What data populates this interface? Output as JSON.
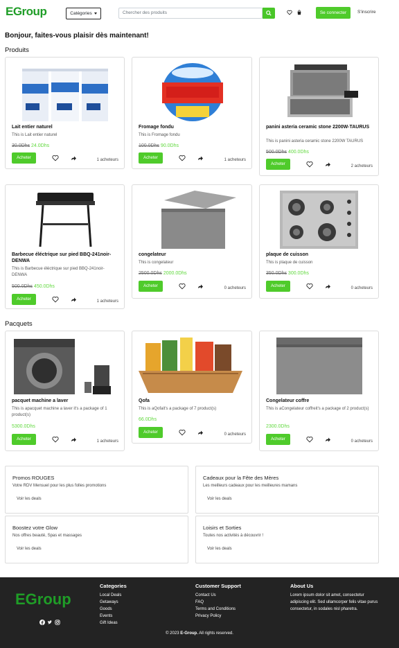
{
  "header": {
    "logo_text": "EGroup",
    "categories_label": "Catégories",
    "search_placeholder": "Chercher des produits",
    "login_label": "Se connecter",
    "signup_label": "S'inscrire"
  },
  "greeting": "Bonjour, faites-vous plaisir dès maintenant!",
  "sections": {
    "products_title": "Produits",
    "packages_title": "Pacquets"
  },
  "products": [
    {
      "name": "Lait entier naturel",
      "desc": "This is Lait entier naturel",
      "old_price": "30.0Dhs",
      "new_price": "24.0Dhs",
      "buy_label": "Acheter",
      "buyers": "1 acheteurs"
    },
    {
      "name": "Fromage fondu",
      "desc": "This is Fromage fondu",
      "old_price": "100.0Dhs",
      "new_price": "90.0Dhs",
      "buy_label": "Acheter",
      "buyers": "1 acheteurs"
    },
    {
      "name": "panini asteria ceramic stone 2200W-TAURUS",
      "desc": "This is panini asteria ceramic stone 2200W TAURUS",
      "old_price": "500.0Dhs",
      "new_price": "400.0Dhs",
      "buy_label": "Acheter",
      "buyers": "2 acheteurs"
    },
    {
      "name": "Barbecue éléctrique sur pied BBQ-241noir-DENWA",
      "desc": "This is Barbecue éléctrique sur pied BBQ-241noir-DENWA",
      "old_price": "500.0Dhs",
      "new_price": "450.0Dhs",
      "buy_label": "Acheter",
      "buyers": "1 acheteurs"
    },
    {
      "name": "congelateur",
      "desc": "This is congelateur",
      "old_price": "2500.0Dhs",
      "new_price": "2000.0Dhs",
      "buy_label": "Acheter",
      "buyers": "0 acheteurs"
    },
    {
      "name": "plaque de cuisson",
      "desc": "This is plaque de cuisson",
      "old_price": "350.0Dhs",
      "new_price": "300.0Dhs",
      "buy_label": "Acheter",
      "buyers": "0 acheteurs"
    }
  ],
  "packages": [
    {
      "name": "pacquet machine a laver",
      "desc": "This is apacquet machine a laver it's a package of 1 product(s)",
      "price": "5300.0Dhs",
      "buy_label": "Acheter",
      "buyers": "1 acheteurs"
    },
    {
      "name": "Qofa",
      "desc": "This is aQofait's a package of 7 product(s)",
      "price": "66.0Dhs",
      "buy_label": "Acheter",
      "buyers": "0 acheteurs"
    },
    {
      "name": "Congelateur coffre",
      "desc": "This is aCongelateur coffreit's a package of 2 product(s)",
      "price": "2300.0Dhs",
      "buy_label": "Acheter",
      "buyers": "0 acheteurs"
    }
  ],
  "promos": [
    {
      "title": "Promos ROUGES",
      "desc": "Votre RDV Mensuel pour les plus folles promotions",
      "link": "Voir les deals"
    },
    {
      "title": "Cadeaux pour la Fête des Mères",
      "desc": "Les meilleurs cadeaux pour les meilleures mamans",
      "link": "Voir les deals"
    },
    {
      "title": "Boostez votre Glow",
      "desc": "Nos offres beauté, Spas et massages",
      "link": "Voir les deals"
    },
    {
      "title": "Loisirs et Sorties",
      "desc": "Toutes nos activités à découvrir !",
      "link": "Voir les deals"
    }
  ],
  "footer": {
    "logo_text": "EGroup",
    "categories_title": "Categories",
    "categories": [
      "Local Deals",
      "Getaways",
      "Goods",
      "Events",
      "Gift Ideas"
    ],
    "support_title": "Customer Support",
    "support": [
      "Contact Us",
      "FAQ",
      "Terms and Conditions",
      "Privacy Policy"
    ],
    "about_title": "About Us",
    "about_text": "Lorem ipsum dolor sit amet, consectetur adipiscing elit. Sed ullamcorper felis vitae purus consectetur, in sodales nisl pharetra.",
    "copyright_prefix": "© 2023",
    "copyright_brand": "E-Group.",
    "copyright_suffix": "All rights reserved."
  },
  "colors": {
    "brand_green": "#4fcb2b",
    "price_green": "#5fd83c",
    "logo_green": "#1f9d27",
    "footer_bg": "#232323"
  }
}
